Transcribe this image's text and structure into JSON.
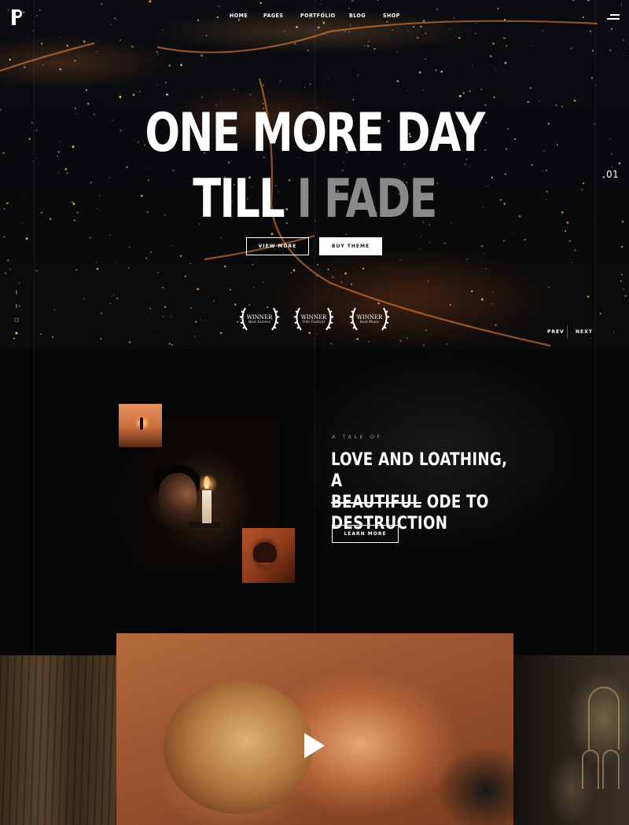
{
  "nav": {
    "items": [
      "HOME",
      "PAGES",
      "PORTFOLIO",
      "BLOG",
      "SHOP"
    ]
  },
  "hero": {
    "title_line1": "ONE MORE DAY",
    "title_line2_a": "TILL",
    "title_line2_b": "I FADE",
    "btn_view_more": "VIEW MORE",
    "btn_buy_theme": "BUY THEME",
    "slide_number": "01",
    "prev_label": "PREV",
    "next_label": "NEXT",
    "awards": [
      {
        "title": "WINNER",
        "subtitle": "Best Actress"
      },
      {
        "title": "WINNER",
        "subtitle": "Film Festival"
      },
      {
        "title": "WINNER",
        "subtitle": "Best Music"
      }
    ],
    "social_icons": [
      "facebook-icon",
      "twitter-icon",
      "instagram-icon",
      "soundcloud-icon"
    ]
  },
  "story": {
    "eyebrow": "A TALE OF",
    "heading_line1": "LOVE AND LOATHING, A",
    "heading_strike": "BEAUTIFUL",
    "heading_rest": "ODE TO",
    "heading_line3": "DESTRUCTION",
    "btn_learn_more": "LEARN MORE"
  },
  "colors": {
    "background": "#050607",
    "accent_text": "#ffffff",
    "dim_text": "#8a8a8a"
  }
}
